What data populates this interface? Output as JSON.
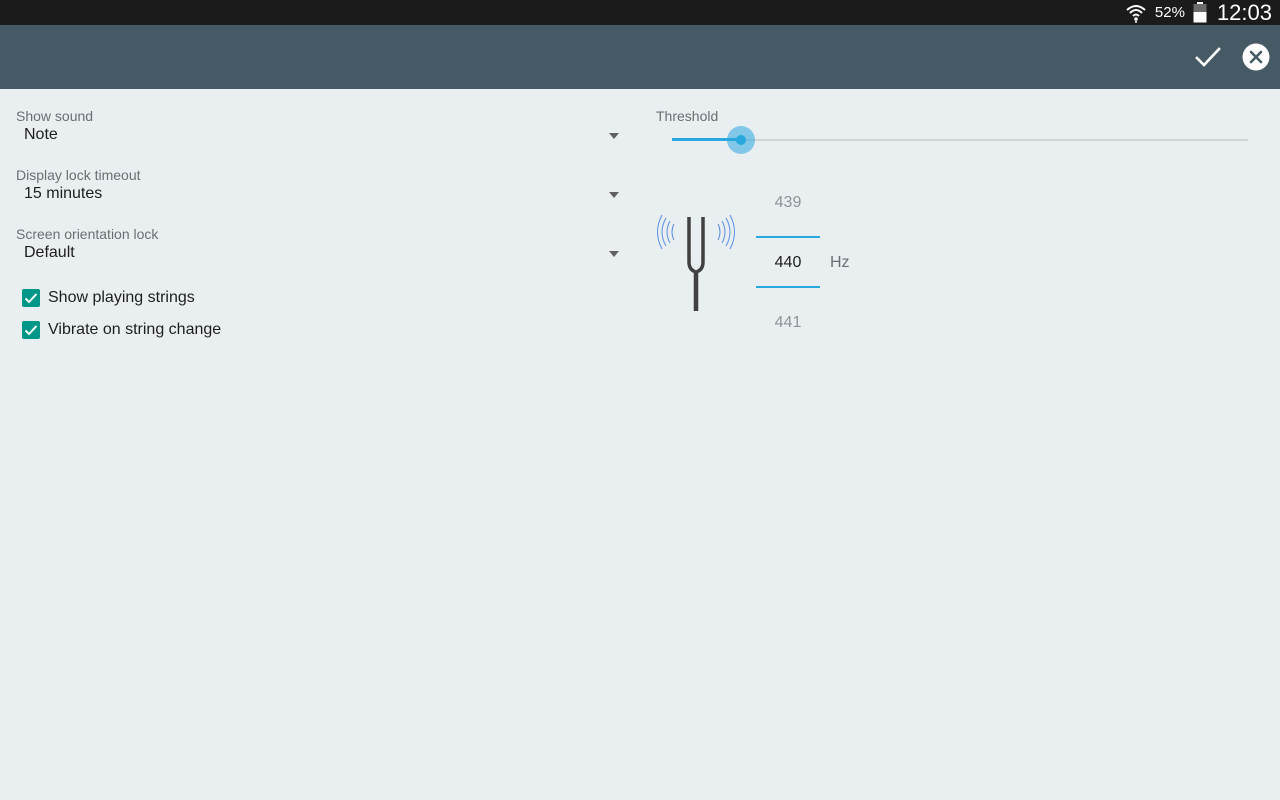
{
  "status_bar": {
    "battery_percent": "52%",
    "time": "12:03",
    "icons": [
      "wifi-icon",
      "battery-icon"
    ]
  },
  "action_bar": {
    "icons": [
      "checkmark-icon",
      "close-circle-icon"
    ]
  },
  "preferences": {
    "show_sound": {
      "label": "Show sound",
      "value": "Note"
    },
    "display_lock_timeout": {
      "label": "Display lock timeout",
      "value": "15 minutes"
    },
    "screen_orientation_lock": {
      "label": "Screen orientation lock",
      "value": "Default"
    },
    "show_playing_strings": {
      "label": "Show playing strings",
      "checked": true
    },
    "vibrate_on_string_change": {
      "label": "Vibrate on string change",
      "checked": true
    }
  },
  "threshold": {
    "label": "Threshold",
    "value_fraction": 0.12
  },
  "pitch": {
    "previous": "439",
    "current": "440",
    "next": "441",
    "unit": "Hz",
    "icon": "tuning-fork-icon"
  },
  "colors": {
    "action_bar": "#455a64",
    "accent": "#29a8e0",
    "checkbox": "#009688",
    "background": "#e9eef1"
  }
}
